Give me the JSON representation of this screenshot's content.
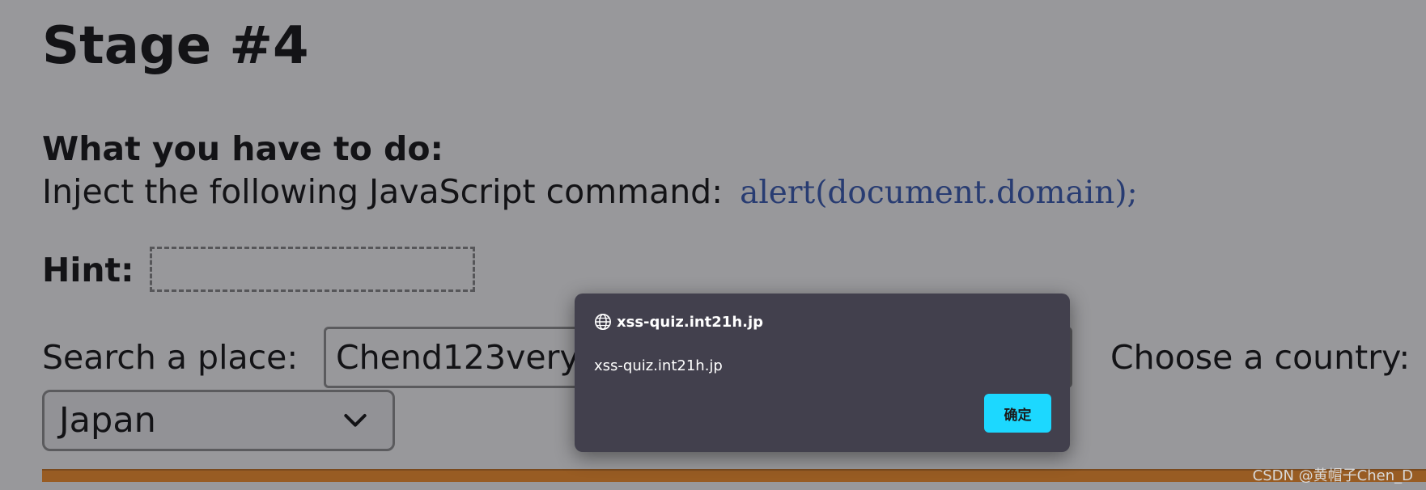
{
  "page": {
    "title": "Stage #4",
    "task_heading": "What you have to do:",
    "task_text": "Inject the following JavaScript command:",
    "task_code": "alert(document.domain);",
    "hint_label": "Hint:",
    "search_label": "Search a place:",
    "search_value": "Chend123very",
    "country_label": "Choose a country:",
    "country_selected": "Japan"
  },
  "dialog": {
    "origin": "xss-quiz.int21h.jp",
    "message": "xss-quiz.int21h.jp",
    "ok_label": "确定"
  },
  "watermark": "CSDN @黄帽子Chen_D",
  "colors": {
    "accent_bar": "#ff8c1a",
    "code_text": "#2a4fb0",
    "dialog_bg": "#42404d",
    "ok_button": "#1cd8ff"
  },
  "icons": {
    "dialog_origin": "globe-icon",
    "select_arrow": "chevron-down-icon"
  }
}
